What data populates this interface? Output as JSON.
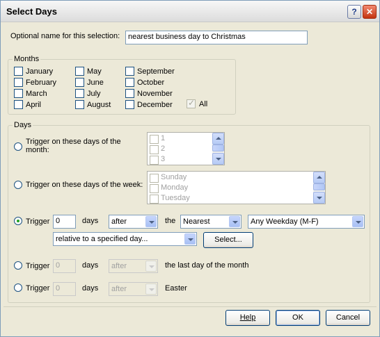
{
  "window": {
    "title": "Select Days",
    "help_glyph": "?",
    "close_glyph": "✕"
  },
  "name_field": {
    "label": "Optional name for this selection:",
    "value": "nearest business day to Christmas"
  },
  "months": {
    "legend": "Months",
    "col1": [
      "January",
      "February",
      "March",
      "April"
    ],
    "col2": [
      "May",
      "June",
      "July",
      "August"
    ],
    "col3": [
      "September",
      "October",
      "November",
      "December"
    ],
    "all_label": "All",
    "all_checked": true
  },
  "days": {
    "legend": "Days",
    "month_option_label_line1": "Trigger on these days of the",
    "month_option_label_line2": "month:",
    "month_items": [
      "1",
      "2",
      "3"
    ],
    "week_option_label": "Trigger on these days of the week:",
    "week_items": [
      "Sunday",
      "Monday",
      "Tuesday"
    ],
    "trigger1": {
      "label": "Trigger",
      "value": "0",
      "days_label": "days",
      "direction": "after",
      "the_label": "the",
      "which": "Nearest",
      "kind": "Any Weekday (M-F)",
      "relative": "relative to a specified day...",
      "select_button": "Select..."
    },
    "trigger2": {
      "label": "Trigger",
      "value": "0",
      "days_label": "days",
      "direction": "after",
      "suffix": "the last day of the month"
    },
    "trigger3": {
      "label": "Trigger",
      "value": "0",
      "days_label": "days",
      "direction": "after",
      "suffix": "Easter"
    }
  },
  "footer": {
    "help_label": "Help",
    "ok_label": "OK",
    "cancel_label": "Cancel"
  },
  "icons": {
    "help": "question-icon",
    "close": "close-icon",
    "check": "checkmark-icon"
  }
}
